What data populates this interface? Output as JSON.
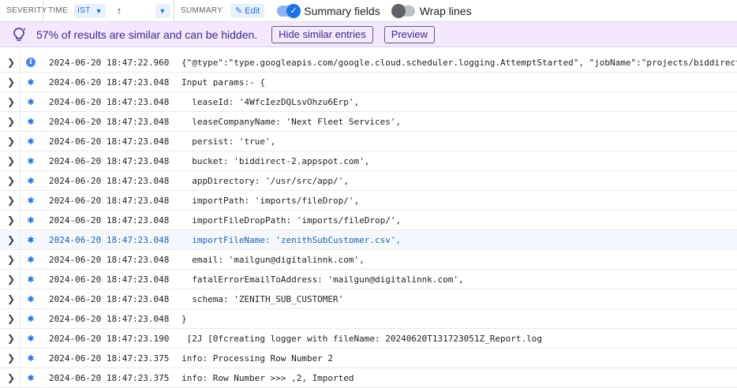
{
  "header": {
    "severity_label": "SEVERITY",
    "time_label": "TIME",
    "timezone": "IST",
    "summary_label": "SUMMARY",
    "edit_label": "Edit",
    "summary_fields_label": "Summary fields",
    "wrap_lines_label": "Wrap lines"
  },
  "banner": {
    "message": "57% of results are similar and can be hidden.",
    "hide_button": "Hide similar entries",
    "preview_button": "Preview"
  },
  "rows": [
    {
      "severity": "info",
      "time": "2024-06-20 18:47:22.960",
      "summary": "{\"@type\":\"type.googleapis.com/google.cloud.scheduler.logging.AttemptStarted\", \"jobName\":\"projects/biddirect"
    },
    {
      "severity": "default",
      "time": "2024-06-20 18:47:23.048",
      "summary": "Input params:- {"
    },
    {
      "severity": "default",
      "time": "2024-06-20 18:47:23.048",
      "summary": "  leaseId: '4WfcIezDQLsvOhzu6Erp',"
    },
    {
      "severity": "default",
      "time": "2024-06-20 18:47:23.048",
      "summary": "  leaseCompanyName: 'Next Fleet Services',"
    },
    {
      "severity": "default",
      "time": "2024-06-20 18:47:23.048",
      "summary": "  persist: 'true',"
    },
    {
      "severity": "default",
      "time": "2024-06-20 18:47:23.048",
      "summary": "  bucket: 'biddirect-2.appspot.com',"
    },
    {
      "severity": "default",
      "time": "2024-06-20 18:47:23.048",
      "summary": "  appDirectory: '/usr/src/app/',"
    },
    {
      "severity": "default",
      "time": "2024-06-20 18:47:23.048",
      "summary": "  importPath: 'imports/fileDrop/',"
    },
    {
      "severity": "default",
      "time": "2024-06-20 18:47:23.048",
      "summary": "  importFileDropPath: 'imports/fileDrop/',"
    },
    {
      "severity": "default",
      "time": "2024-06-20 18:47:23.048",
      "summary": "  importFileName: 'zenithSubCustomer.csv',"
    },
    {
      "severity": "default",
      "time": "2024-06-20 18:47:23.048",
      "summary": "  email: 'mailgun@digitalinnk.com',"
    },
    {
      "severity": "default",
      "time": "2024-06-20 18:47:23.048",
      "summary": "  fatalErrorEmailToAddress: 'mailgun@digitalinnk.com',"
    },
    {
      "severity": "default",
      "time": "2024-06-20 18:47:23.048",
      "summary": "  schema: 'ZENITH_SUB_CUSTOMER'"
    },
    {
      "severity": "default",
      "time": "2024-06-20 18:47:23.048",
      "summary": "}"
    },
    {
      "severity": "default",
      "time": "2024-06-20 18:47:23.190",
      "summary": " [2J [0fcreating logger with fileName: 20240620T131723051Z_Report.log"
    },
    {
      "severity": "default",
      "time": "2024-06-20 18:47:23.375",
      "summary": "info: Processing Row Number 2"
    },
    {
      "severity": "default",
      "time": "2024-06-20 18:47:23.375",
      "summary": "info: Row Number >>> ,2, Imported"
    }
  ],
  "highlighted_row": 9,
  "colors": {
    "accent": "#1a73e8",
    "banner_bg": "#f3e8fd",
    "highlight_row": "#f4f8fe"
  }
}
